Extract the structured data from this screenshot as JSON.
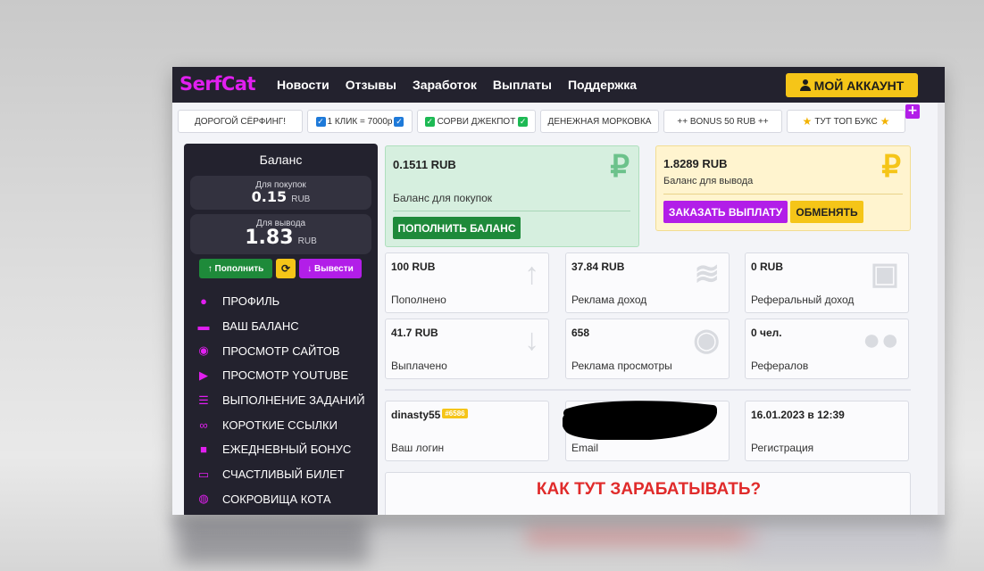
{
  "header": {
    "logo": "SerfCat",
    "nav": [
      "Новости",
      "Отзывы",
      "Заработок",
      "Выплаты",
      "Поддержка"
    ],
    "account_button": "МОЙ АККАУНТ"
  },
  "banners": {
    "b1": "ДОРОГОЙ СЁРФИНГ!",
    "b2": "1 КЛИК = 7000р",
    "b3": "СОРВИ ДЖЕКПОТ",
    "b4": "ДЕНЕЖНАЯ МОРКОВКА",
    "b5": "++ BONUS 50 RUB ++",
    "b6": "ТУТ ТОП БУКС",
    "plus": "+"
  },
  "sidebar": {
    "title": "Баланс",
    "purchase_caption": "Для покупок",
    "purchase_value": "0.15",
    "purchase_currency": "RUB",
    "withdraw_caption": "Для вывода",
    "withdraw_value": "1.83",
    "withdraw_currency": "RUB",
    "topup_button": "Пополнить",
    "withdraw_button": "Вывести",
    "menu": [
      {
        "label": "ПРОФИЛЬ",
        "icon": "user-icon"
      },
      {
        "label": "ВАШ БАЛАНС",
        "icon": "wallet-icon"
      },
      {
        "label": "ПРОСМОТР САЙТОВ",
        "icon": "eye-icon"
      },
      {
        "label": "ПРОСМОТР YOUTUBE",
        "icon": "play-icon"
      },
      {
        "label": "ВЫПОЛНЕНИЕ ЗАДАНИЙ",
        "icon": "list-icon"
      },
      {
        "label": "КОРОТКИЕ ССЫЛКИ",
        "icon": "link-icon"
      },
      {
        "label": "ЕЖЕДНЕВНЫЙ БОНУС",
        "icon": "gift-icon"
      },
      {
        "label": "СЧАСТЛИВЫЙ БИЛЕТ",
        "icon": "ticket-icon"
      },
      {
        "label": "СОКРОВИЩА КОТА",
        "icon": "coins-icon"
      }
    ]
  },
  "balances": {
    "purchase_value": "0.1511 RUB",
    "purchase_label": "Баланс для покупок",
    "topup_button": "ПОПОЛНИТЬ БАЛАНС",
    "withdraw_value": "1.8289 RUB",
    "withdraw_label": "Баланс для вывода",
    "order_payout_button": "ЗАКАЗАТЬ ВЫПЛАТУ",
    "exchange_button": "ОБМЕНЯТЬ",
    "ruble_sign": "₽"
  },
  "stats": [
    {
      "value": "100 RUB",
      "label": "Пополнено"
    },
    {
      "value": "37.84 RUB",
      "label": "Реклама доход"
    },
    {
      "value": "0 RUB",
      "label": "Реферальный доход"
    },
    {
      "value": "41.7 RUB",
      "label": "Выплачено"
    },
    {
      "value": "658",
      "label": "Реклама просмотры"
    },
    {
      "value": "0 чел.",
      "label": "Рефералов"
    }
  ],
  "account": {
    "login_value": "dinasty55",
    "login_id": "#6586",
    "login_label": "Ваш логин",
    "email_label": "Email",
    "reg_value": "16.01.2023 в 12:39",
    "reg_label": "Регистрация"
  },
  "how_title": "КАК ТУТ ЗАРАБАТЫВАТЬ?",
  "colors": {
    "accent": "#e11ff0",
    "topbar": "#23222e",
    "yellow": "#f5c518",
    "green": "#1e8a3a",
    "purple": "#b21ee8"
  }
}
